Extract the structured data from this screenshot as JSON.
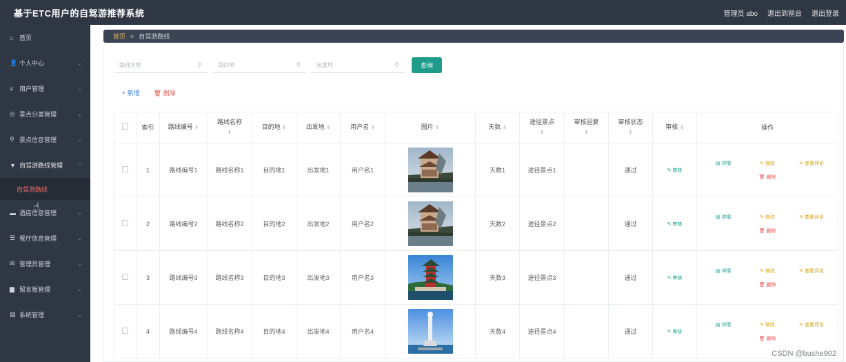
{
  "header": {
    "title": "基于ETC用户的自驾游推荐系统",
    "links": [
      "管理员 abo",
      "退出到前台",
      "退出登录"
    ]
  },
  "sidebar": {
    "items": [
      {
        "label": "首页",
        "icon": "home-icon",
        "glyph": "⌂",
        "chevron": ""
      },
      {
        "label": "个人中心",
        "icon": "user-icon",
        "glyph": "👤",
        "chevron": "⌄"
      },
      {
        "label": "用户管理",
        "icon": "list-icon",
        "glyph": "≡",
        "chevron": "⌄"
      },
      {
        "label": "景点分类管理",
        "icon": "compass-icon",
        "glyph": "◎",
        "chevron": "⌄"
      },
      {
        "label": "景点信息管理",
        "icon": "pin-icon",
        "glyph": "⚲",
        "chevron": "⌄"
      },
      {
        "label": "自驾游路线管理",
        "icon": "map-icon",
        "glyph": "▼",
        "chevron": "⌃"
      },
      {
        "label": "自驾游路线",
        "icon": "",
        "glyph": "",
        "chevron": ""
      },
      {
        "label": "酒店信息管理",
        "icon": "hotel-icon",
        "glyph": "▬",
        "chevron": "⌄"
      },
      {
        "label": "餐厅信息管理",
        "icon": "sliders-icon",
        "glyph": "☰",
        "chevron": "⌄"
      },
      {
        "label": "管理员管理",
        "icon": "mail-icon",
        "glyph": "✉",
        "chevron": "⌄"
      },
      {
        "label": "留言板管理",
        "icon": "board-icon",
        "glyph": "▆",
        "chevron": "⌄"
      },
      {
        "label": "系统管理",
        "icon": "settings-icon",
        "glyph": "▤",
        "chevron": "⌄"
      }
    ]
  },
  "breadcrumb": {
    "home": "首页",
    "separator": ">",
    "current": "自驾游路线"
  },
  "search": {
    "route_name_placeholder": "路线名称",
    "destination_placeholder": "目的地",
    "origin_placeholder": "出发地",
    "query_label": "查询"
  },
  "actions": {
    "add_label": "+ 新增",
    "delete_label": "删除"
  },
  "table": {
    "headers": {
      "index": "索引",
      "route_no": "路线编号",
      "route_name": "路线名称",
      "destination": "目的地",
      "origin": "出发地",
      "username": "用户名",
      "image": "图片",
      "days": "天数",
      "via_spots": "途径景点",
      "review_reply": "审核回复",
      "review_status": "审核状态",
      "review": "审核",
      "operations": "操作"
    },
    "rows": [
      {
        "index": "1",
        "route_no": "路线编号1",
        "route_name": "路线名称1",
        "destination": "目的地1",
        "origin": "出发地1",
        "username": "用户名1",
        "days": "天数1",
        "via_spots": "途径景点1",
        "review_reply": "",
        "review_status": "通过",
        "image": "pavilion"
      },
      {
        "index": "2",
        "route_no": "路线编号2",
        "route_name": "路线名称2",
        "destination": "目的地2",
        "origin": "出发地2",
        "username": "用户名2",
        "days": "天数2",
        "via_spots": "途径景点2",
        "review_reply": "",
        "review_status": "通过",
        "image": "pavilion"
      },
      {
        "index": "3",
        "route_no": "路线编号3",
        "route_name": "路线名称3",
        "destination": "目的地3",
        "origin": "出发地3",
        "username": "用户名3",
        "days": "天数3",
        "via_spots": "途径景点3",
        "review_reply": "",
        "review_status": "通过",
        "image": "tower"
      },
      {
        "index": "4",
        "route_no": "路线编号4",
        "route_name": "路线名称4",
        "destination": "目的地4",
        "origin": "出发地4",
        "username": "用户名4",
        "days": "天数4",
        "via_spots": "途径景点4",
        "review_reply": "",
        "review_status": "通过",
        "image": "statue"
      }
    ],
    "row_actions": {
      "review": "审核",
      "detail": "详情",
      "edit": "修改",
      "view_comments": "查看评论",
      "delete": "删除"
    }
  },
  "watermark": "CSDN @bushe902",
  "colors": {
    "sidebar_bg": "#2f3744",
    "accent_teal": "#1e9b8a",
    "active_submenu": "#f26d6d",
    "delete_red": "#e25656",
    "edit_gold": "#d4a106"
  }
}
